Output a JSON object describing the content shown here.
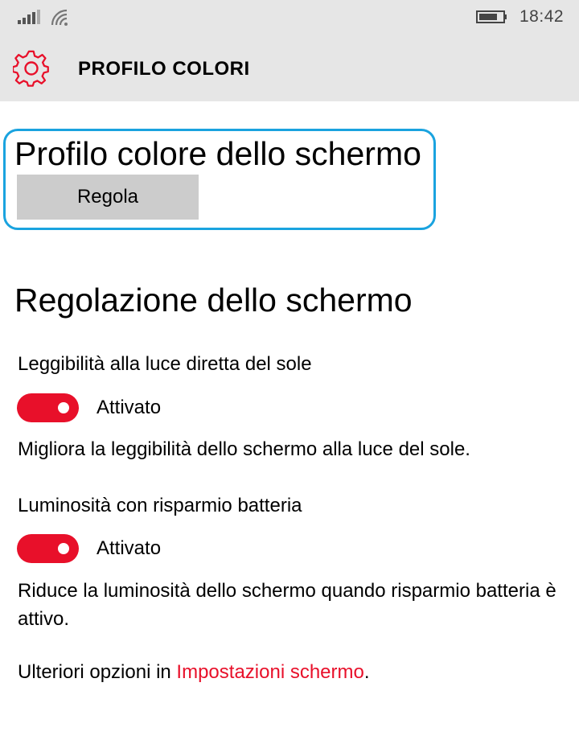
{
  "status_bar": {
    "time": "18:42",
    "icons": [
      "signal-strength-icon",
      "wifi-icon",
      "battery-icon"
    ]
  },
  "header": {
    "icon": "gear-icon",
    "title": "PROFILO COLORI"
  },
  "color_profile": {
    "heading": "Profilo colore dello schermo",
    "button_label": "Regola"
  },
  "display_adjustment": {
    "heading": "Regolazione dello schermo",
    "settings": [
      {
        "label": "Leggibilità alla luce diretta del sole",
        "state": "Attivato",
        "enabled": true,
        "description": "Migliora la leggibilità dello schermo alla luce del sole."
      },
      {
        "label": "Luminosità con risparmio batteria",
        "state": "Attivato",
        "enabled": true,
        "description": "Riduce la luminosità dello schermo quando risparmio batteria è attivo."
      }
    ]
  },
  "footer": {
    "prefix": "Ulteriori opzioni in ",
    "link": "Impostazioni schermo",
    "suffix": "."
  },
  "colors": {
    "accent": "#e8102a",
    "header_background": "#e6e6e6",
    "focus_frame": "#1aa3df",
    "button_background": "#cccccc"
  }
}
